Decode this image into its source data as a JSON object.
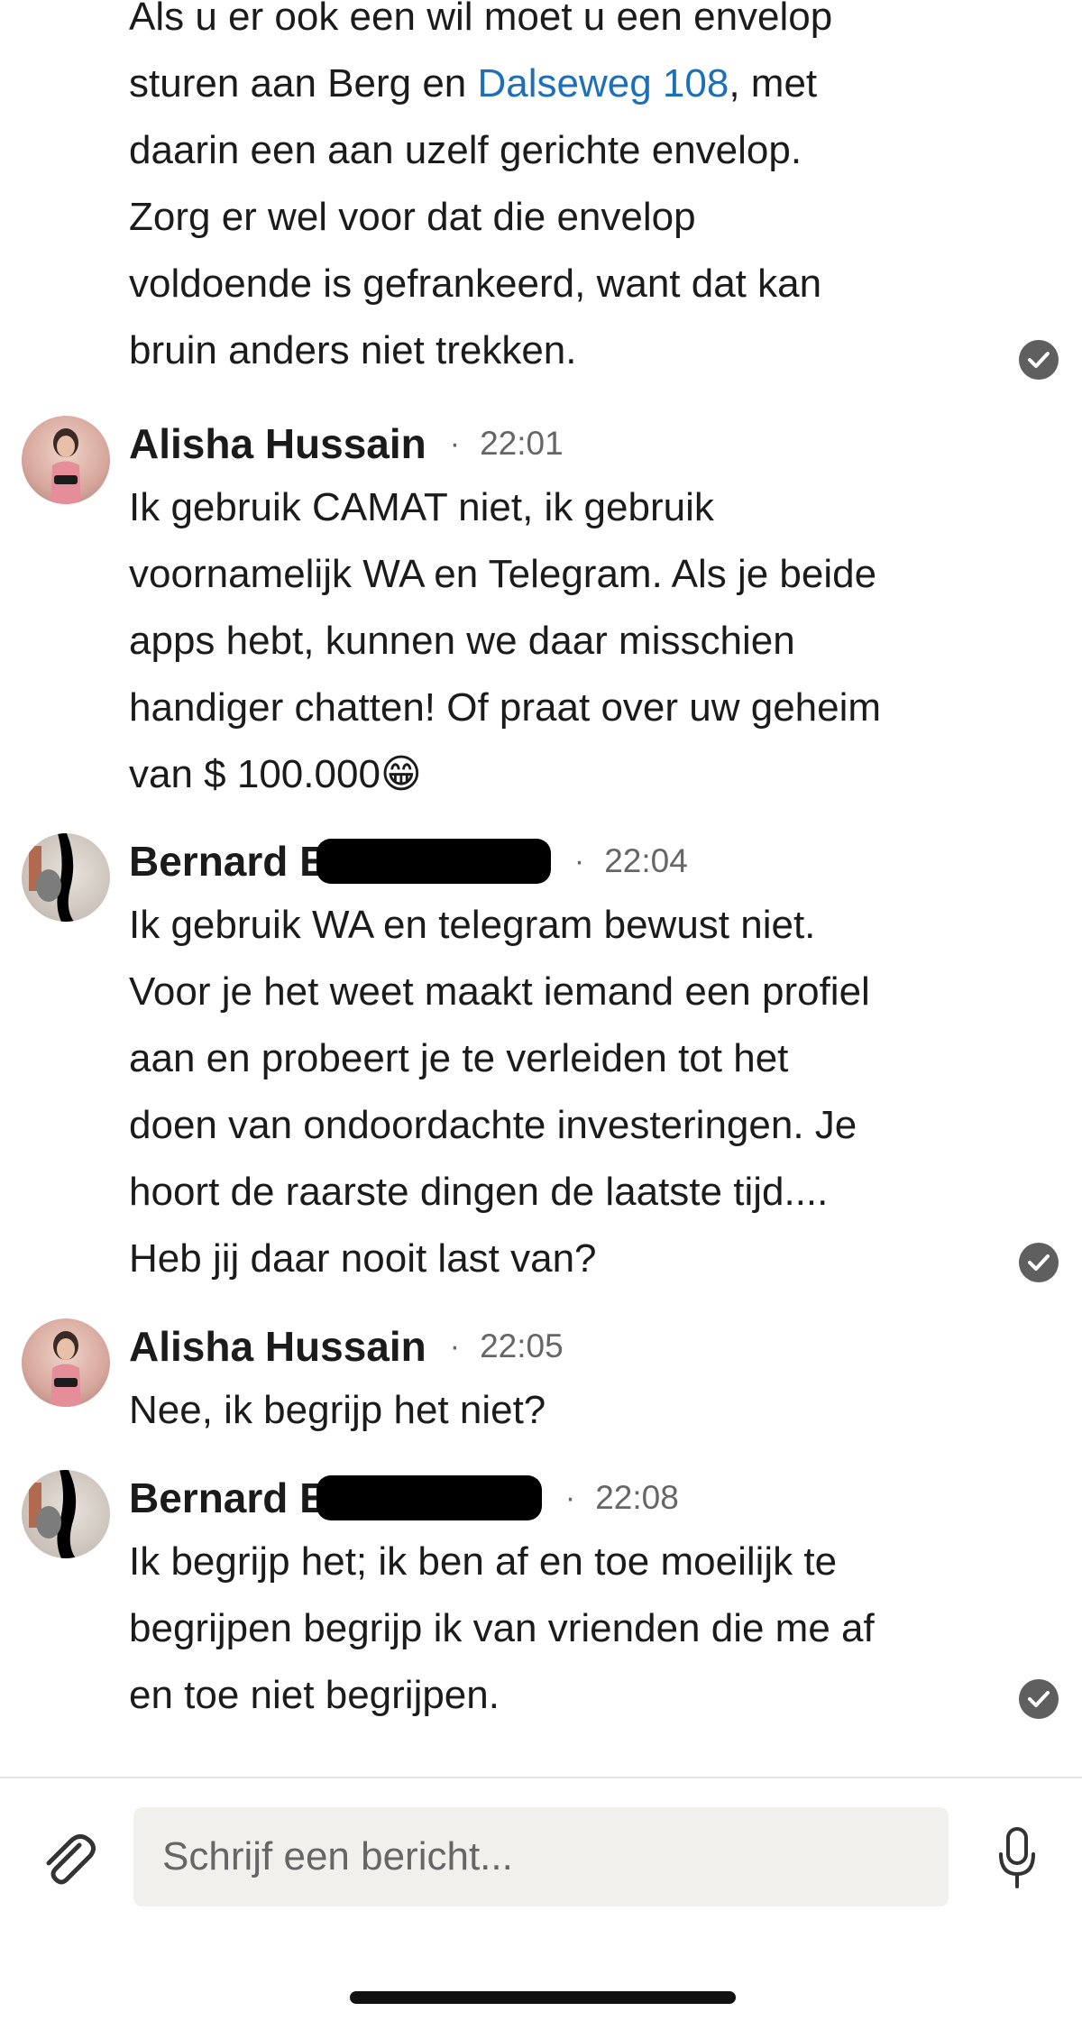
{
  "thread": {
    "messages": [
      {
        "lines": [
          "Als u er ook een wil moet u een envelop",
          "",
          "daarin een aan uzelf gerichte envelop.",
          "Zorg er wel voor dat die envelop",
          "voldoende is gefrankeerd, want dat kan",
          "bruin anders niet trekken."
        ],
        "line2_prefix": "sturen aan Berg en ",
        "line2_link": "Dalseweg 108",
        "line2_suffix": ", met",
        "read": true
      },
      {
        "sender": "Alisha Hussain",
        "time": "22:01",
        "lines": [
          "Ik gebruik CAMAT niet, ik gebruik",
          "voornamelijk WA en Telegram. Als je beide",
          "apps hebt, kunnen we daar misschien",
          "handiger chatten! Of praat over uw geheim",
          "van $ 100.000😁"
        ]
      },
      {
        "sender": "Bernard E",
        "time": "22:04",
        "lines": [
          "Ik gebruik WA en telegram bewust niet.",
          "Voor je het weet maakt iemand een profiel",
          "aan en probeert je te verleiden tot het",
          "doen van ondoordachte investeringen. Je",
          "hoort de raarste dingen de laatste tijd....",
          "Heb jij daar nooit last van?"
        ],
        "read": true
      },
      {
        "sender": "Alisha Hussain",
        "time": "22:05",
        "lines": [
          "Nee, ik begrijp het niet?"
        ]
      },
      {
        "sender": "Bernard E",
        "time": "22:08",
        "lines": [
          "Ik begrijp het; ik ben af en toe moeilijk te",
          "begrijpen begrijp ik van vrienden die me af",
          "en toe niet begrijpen."
        ],
        "read": true
      }
    ],
    "separator": "·"
  },
  "composer": {
    "placeholder": "Schrijf een bericht...",
    "attach_icon": "paperclip-icon",
    "mic_icon": "microphone-icon"
  },
  "colors": {
    "link": "#1d6fb8",
    "check": "#5f5f5f",
    "input_bg": "#f1f0ed"
  }
}
